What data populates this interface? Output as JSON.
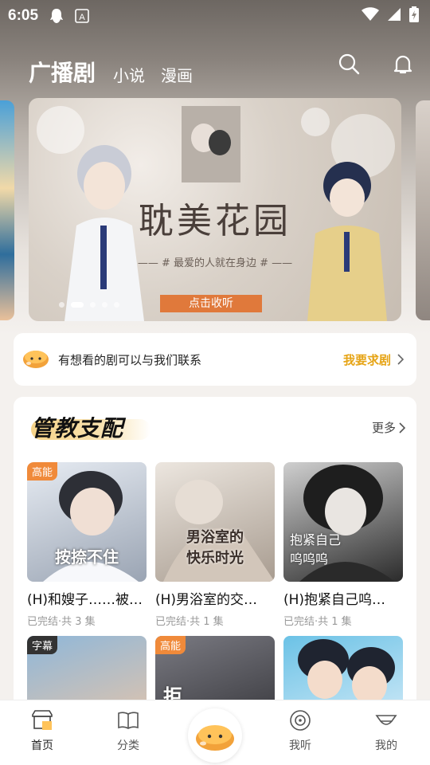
{
  "status_bar": {
    "time": "6:05",
    "icons": [
      "qq-icon",
      "a-icon",
      "wifi-icon",
      "signal-icon",
      "battery-icon"
    ]
  },
  "top_nav": {
    "tabs": [
      {
        "label": "广播剧",
        "active": true
      },
      {
        "label": "小说",
        "active": false
      },
      {
        "label": "漫画",
        "active": false
      }
    ],
    "icons": [
      "search-icon",
      "bell-icon"
    ]
  },
  "banner": {
    "title": "耽美花园",
    "subtitle": "—— # 最爱的人就在身边 # ——",
    "button": "点击收听",
    "page_count": 5,
    "active_page": 1
  },
  "request_bar": {
    "text": "有想看的剧可以与我们联系",
    "link": "我要求剧"
  },
  "section": {
    "title": "管教支配",
    "more": "更多",
    "cards": [
      {
        "tag": "高能",
        "cover_text": "按捺不住",
        "title": "(H)和嫂子……被…",
        "meta": "已完结·共 3 集",
        "cover_colors": [
          "#9aa4b3",
          "#e6ebf2"
        ]
      },
      {
        "tag": "",
        "cover_text": "男浴室的\n快乐时光",
        "title": "(H)男浴室的交…",
        "meta": "已完结·共 1 集",
        "cover_colors": [
          "#d8cfc5",
          "#a89c90"
        ]
      },
      {
        "tag": "",
        "cover_text": "抱紧自己\n呜呜呜",
        "title": "(H)抱紧自己呜…",
        "meta": "已完结·共 1 集",
        "cover_colors": [
          "#2b2b2b",
          "#cfcfcf"
        ]
      },
      {
        "tag": "字幕",
        "cover_text": "",
        "title": "",
        "meta": "",
        "cover_colors": [
          "#f3c7a2",
          "#8fb7d9"
        ]
      },
      {
        "tag": "高能",
        "cover_text": "拒",
        "title": "",
        "meta": "",
        "cover_colors": [
          "#2a2a2e",
          "#7a7a82"
        ]
      },
      {
        "tag": "",
        "cover_text": "",
        "title": "",
        "meta": "",
        "cover_colors": [
          "#6bc2e6",
          "#e8f3fb"
        ]
      }
    ]
  },
  "bottom_nav": {
    "items": [
      {
        "label": "首页",
        "active": true
      },
      {
        "label": "分类",
        "active": false
      },
      {
        "label": "我听",
        "active": false
      },
      {
        "label": "我的",
        "active": false
      }
    ]
  },
  "colors": {
    "accent": "#e6a415",
    "tag_high": "#f08a3a",
    "tag_subtitle": "#333333"
  }
}
